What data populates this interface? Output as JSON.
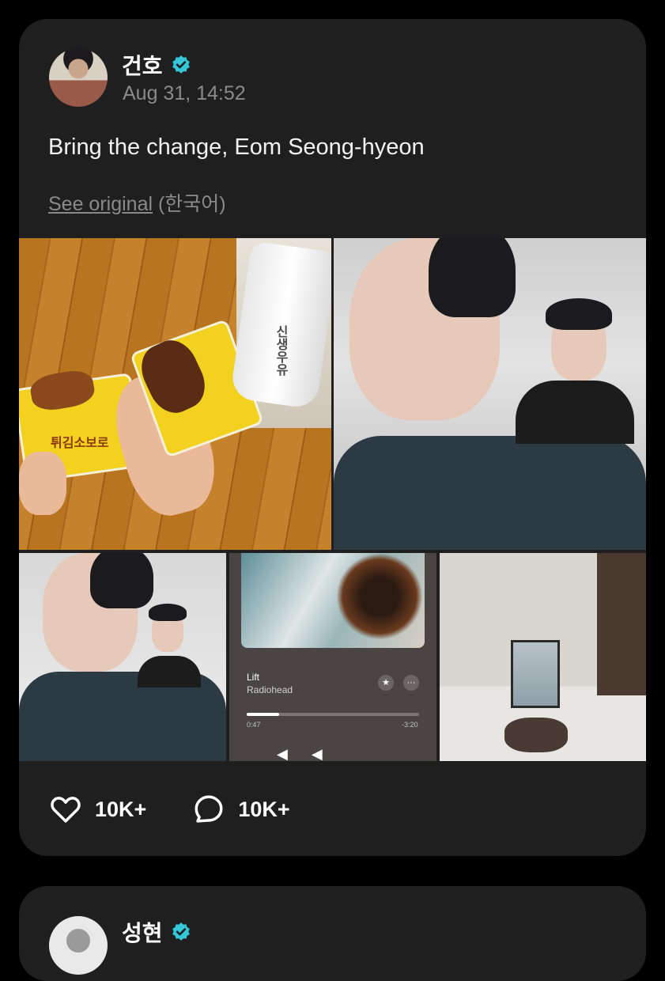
{
  "post": {
    "author": "건호",
    "timestamp": "Aug 31, 14:52",
    "body": "Bring the change, Eom Seong-hyeon",
    "see_original": "See original",
    "original_language": "(한국어)",
    "verified_badge_color": "#35c6d8",
    "gallery": [
      {
        "name": "snack-photo",
        "label_text": "튀김소보로",
        "bottle_text": "신생우유"
      },
      {
        "name": "selfie-photo"
      },
      {
        "name": "selfie-photo-2"
      },
      {
        "name": "music-player-screenshot",
        "song": "Lift",
        "artist": "Radiohead",
        "elapsed": "0:47",
        "remaining": "-3:20",
        "progress": 0.19
      },
      {
        "name": "dog-room-photo"
      }
    ],
    "likes": "10K+",
    "comments": "10K+"
  },
  "next_post": {
    "author": "성현"
  },
  "colors": {
    "background": "#000000",
    "card": "#1f1f1f",
    "muted_text": "#8a8a8a"
  }
}
